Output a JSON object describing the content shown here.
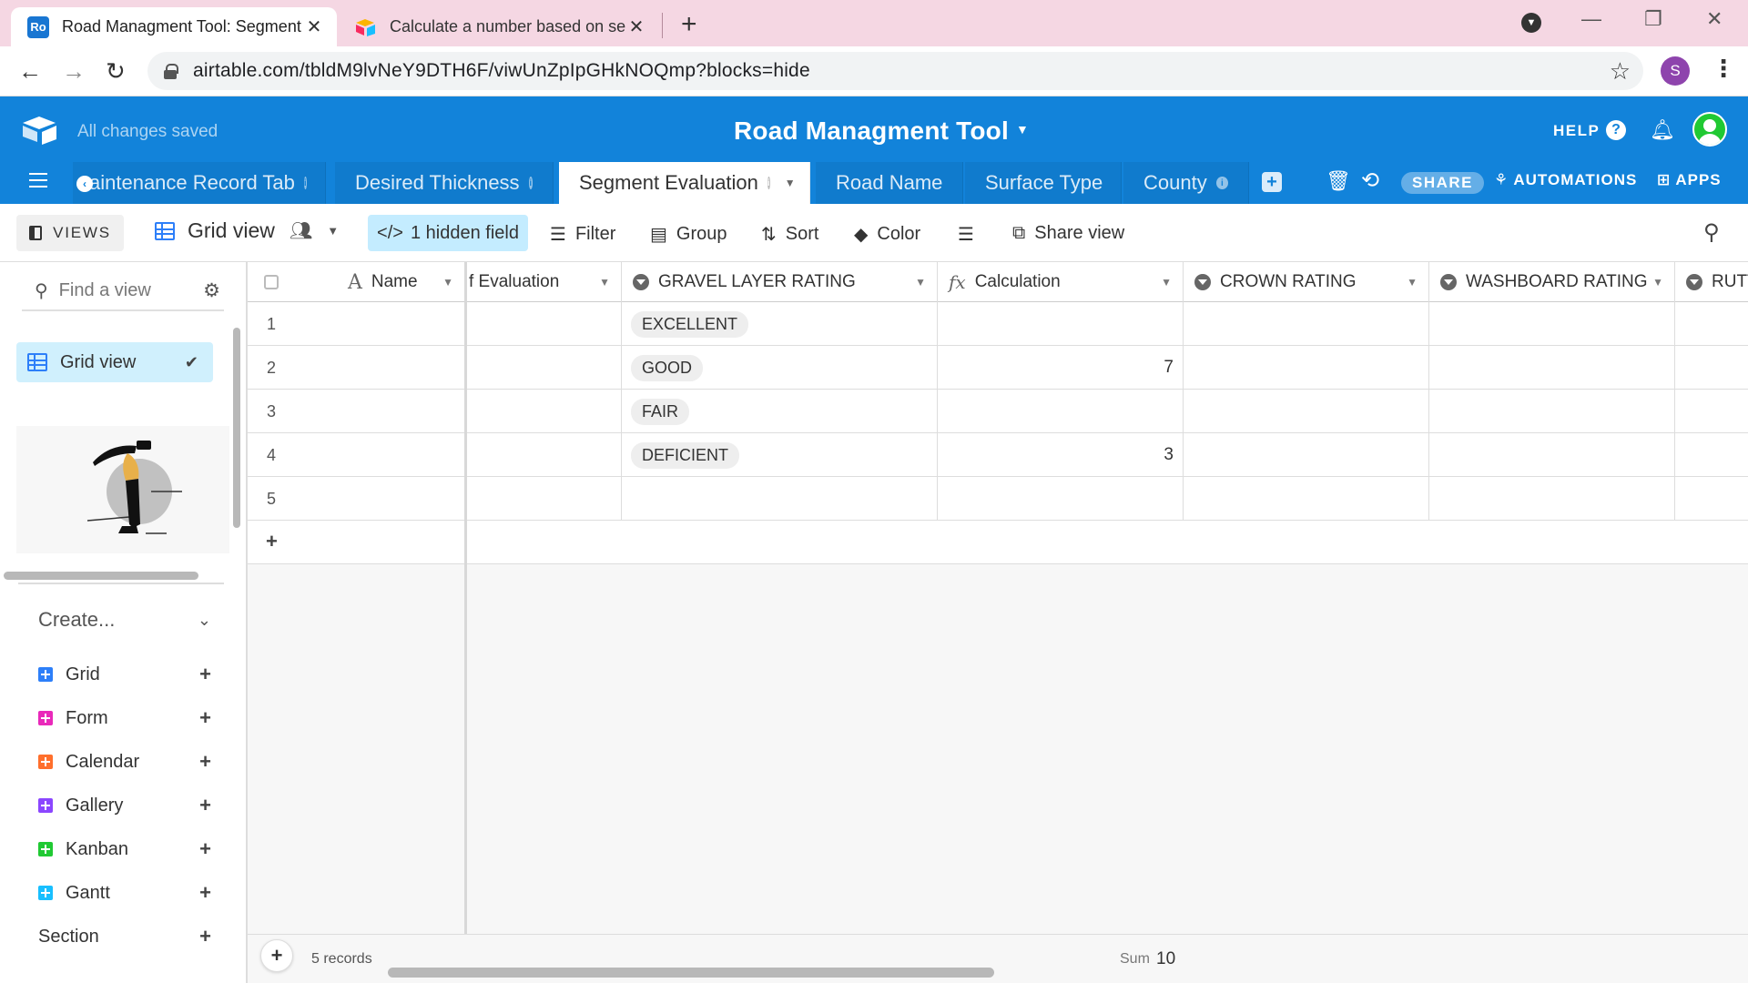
{
  "browser": {
    "tabs": [
      {
        "favicon": "Ro",
        "title": "Road Managment Tool: Segment",
        "active": true
      },
      {
        "favicon": "airtable-logo",
        "title": "Calculate a number based on sel",
        "active": false
      }
    ],
    "url": "airtable.com/tbldM9lvNeY9DTH6F/viwUnZpIpGHkNOQmp?blocks=hide",
    "profile_initial": "S"
  },
  "header": {
    "save_status": "All changes saved",
    "base_title": "Road Managment Tool",
    "help_label": "HELP",
    "tables": [
      {
        "label": "aintenance Record Tab",
        "active": false
      },
      {
        "label": "Desired Thickness",
        "active": false
      },
      {
        "label": "Segment Evaluation",
        "active": true
      },
      {
        "label": "Road Name",
        "active": false
      },
      {
        "label": "Surface Type",
        "active": false
      },
      {
        "label": "County",
        "active": false
      }
    ],
    "share_label": "SHARE",
    "automations_label": "AUTOMATIONS",
    "apps_label": "APPS",
    "accent_color": "#1283da"
  },
  "viewbar": {
    "views_label": "VIEWS",
    "current_view": "Grid view",
    "hidden_fields": "1 hidden field",
    "filter": "Filter",
    "group": "Group",
    "sort": "Sort",
    "color": "Color",
    "share_view": "Share view"
  },
  "sidebar": {
    "find_placeholder": "Find a view",
    "selected_view": "Grid view",
    "create_label": "Create...",
    "view_types": [
      {
        "label": "Grid",
        "color": "#2d7ff9"
      },
      {
        "label": "Form",
        "color": "#e929ba"
      },
      {
        "label": "Calendar",
        "color": "#ff6f2c"
      },
      {
        "label": "Gallery",
        "color": "#8b46ff"
      },
      {
        "label": "Kanban",
        "color": "#20c933"
      },
      {
        "label": "Gantt",
        "color": "#18bfff"
      }
    ],
    "section_label": "Section"
  },
  "grid": {
    "columns": [
      "Name",
      "f Evaluation",
      "GRAVEL LAYER RATING",
      "Calculation",
      "CROWN RATING",
      "WASHBOARD RATING",
      "RUTT"
    ],
    "rows": [
      {
        "num": "1",
        "gravel": "EXCELLENT",
        "calc": ""
      },
      {
        "num": "2",
        "gravel": "GOOD",
        "calc": "7"
      },
      {
        "num": "3",
        "gravel": "FAIR",
        "calc": ""
      },
      {
        "num": "4",
        "gravel": "DEFICIENT",
        "calc": "3"
      },
      {
        "num": "5",
        "gravel": "",
        "calc": ""
      }
    ],
    "records_count": "5 records",
    "sum_label": "Sum",
    "sum_value": "10"
  }
}
